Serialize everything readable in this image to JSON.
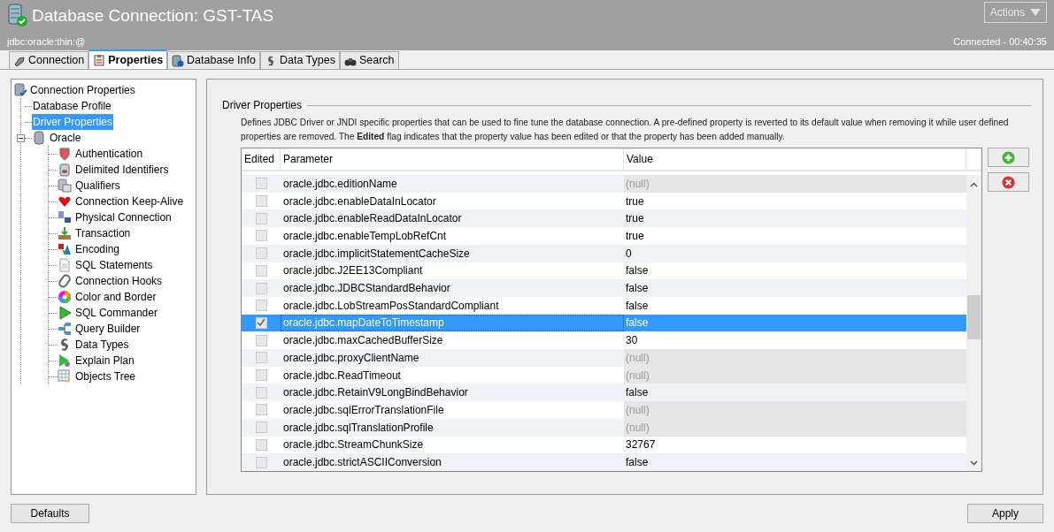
{
  "window": {
    "title": "Database Connection: GST-TAS",
    "url": "jdbc:oracle:thin:@",
    "status": "Connected - 00:40:35",
    "actions_button": "Actions"
  },
  "tabs": [
    {
      "label": "Connection",
      "selected": false
    },
    {
      "label": "Properties",
      "selected": true
    },
    {
      "label": "Database Info",
      "selected": false
    },
    {
      "label": "Data Types",
      "selected": false
    },
    {
      "label": "Search",
      "selected": false
    }
  ],
  "tree": [
    {
      "label": "Connection Properties",
      "selected": false,
      "children": [
        {
          "label": "Database Profile",
          "selected": false
        },
        {
          "label": "Driver Properties",
          "selected": true
        },
        {
          "label": "Oracle",
          "selected": false,
          "expanded": true,
          "children": [
            {
              "label": "Authentication",
              "selected": false
            },
            {
              "label": "Delimited Identifiers",
              "selected": false
            },
            {
              "label": "Qualifiers",
              "selected": false
            },
            {
              "label": "Connection Keep-Alive",
              "selected": false
            },
            {
              "label": "Physical Connection",
              "selected": false
            },
            {
              "label": "Transaction",
              "selected": false
            },
            {
              "label": "Encoding",
              "selected": false
            },
            {
              "label": "SQL Statements",
              "selected": false
            },
            {
              "label": "Connection Hooks",
              "selected": false
            },
            {
              "label": "Color and Border",
              "selected": false
            },
            {
              "label": "SQL Commander",
              "selected": false
            },
            {
              "label": "Query Builder",
              "selected": false
            },
            {
              "label": "Data Types",
              "selected": false
            },
            {
              "label": "Explain Plan",
              "selected": false
            },
            {
              "label": "Objects Tree",
              "selected": false
            }
          ]
        }
      ]
    }
  ],
  "section": {
    "title": "Driver Properties",
    "description": "Defines JDBC Driver or JNDI specific properties that can be used to fine tune the database connection. A pre-defined property is reverted to its default value when removing it while user defined properties are removed. The **Edited** flag indicates that the property value has been edited or that the property has been added manually."
  },
  "table": {
    "columns": [
      "Edited",
      "Parameter",
      "Value"
    ],
    "rows": [
      {
        "edited": false,
        "selected": false,
        "parameter": "oracle.jdbc.editionName",
        "value": "(null)",
        "kind": "null"
      },
      {
        "edited": false,
        "selected": false,
        "parameter": "oracle.jdbc.enableDataInLocator",
        "value": "true",
        "kind": "set"
      },
      {
        "edited": false,
        "selected": false,
        "parameter": "oracle.jdbc.enableReadDataInLocator",
        "value": "true",
        "kind": "set"
      },
      {
        "edited": false,
        "selected": false,
        "parameter": "oracle.jdbc.enableTempLobRefCnt",
        "value": "true",
        "kind": "set"
      },
      {
        "edited": false,
        "selected": false,
        "parameter": "oracle.jdbc.implicitStatementCacheSize",
        "value": "0",
        "kind": "set"
      },
      {
        "edited": false,
        "selected": false,
        "parameter": "oracle.jdbc.J2EE13Compliant",
        "value": "false",
        "kind": "set"
      },
      {
        "edited": false,
        "selected": false,
        "parameter": "oracle.jdbc.JDBCStandardBehavior",
        "value": "false",
        "kind": "set"
      },
      {
        "edited": false,
        "selected": false,
        "parameter": "oracle.jdbc.LobStreamPosStandardCompliant",
        "value": "false",
        "kind": "set"
      },
      {
        "edited": true,
        "selected": true,
        "parameter": "oracle.jdbc.mapDateToTimestamp",
        "value": "false",
        "kind": "set"
      },
      {
        "edited": false,
        "selected": false,
        "parameter": "oracle.jdbc.maxCachedBufferSize",
        "value": "30",
        "kind": "set"
      },
      {
        "edited": false,
        "selected": false,
        "parameter": "oracle.jdbc.proxyClientName",
        "value": "(null)",
        "kind": "null"
      },
      {
        "edited": false,
        "selected": false,
        "parameter": "oracle.jdbc.ReadTimeout",
        "value": "(null)",
        "kind": "null"
      },
      {
        "edited": false,
        "selected": false,
        "parameter": "oracle.jdbc.RetainV9LongBindBehavior",
        "value": "false",
        "kind": "set"
      },
      {
        "edited": false,
        "selected": false,
        "parameter": "oracle.jdbc.sqlErrorTranslationFile",
        "value": "(null)",
        "kind": "null"
      },
      {
        "edited": false,
        "selected": false,
        "parameter": "oracle.jdbc.sqlTranslationProfile",
        "value": "(null)",
        "kind": "null"
      },
      {
        "edited": false,
        "selected": false,
        "parameter": "oracle.jdbc.StreamChunkSize",
        "value": "32767",
        "kind": "set"
      },
      {
        "edited": false,
        "selected": false,
        "parameter": "oracle.jdbc.strictASCIIConversion",
        "value": "false",
        "kind": "set"
      }
    ]
  },
  "buttons": {
    "left": "Defaults",
    "right": "Apply"
  }
}
